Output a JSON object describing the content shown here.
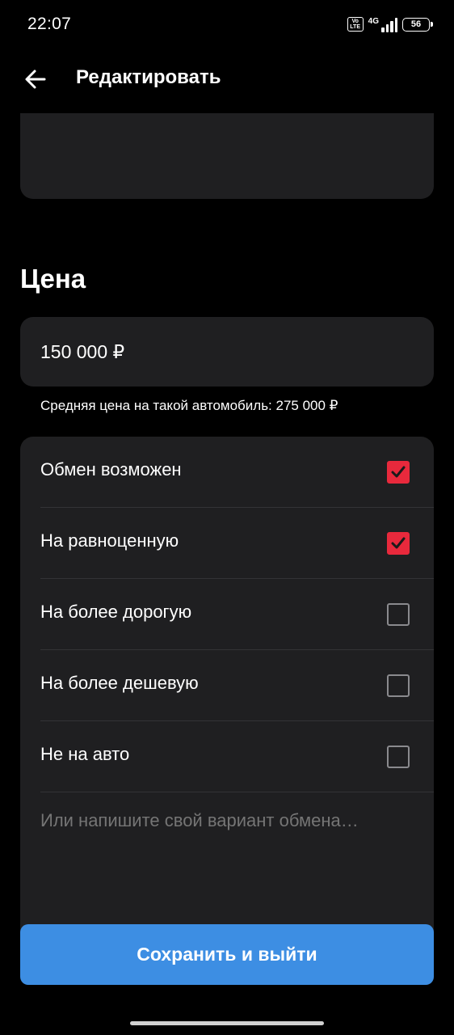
{
  "status_bar": {
    "time": "22:07",
    "volte_label": "Vo LTE",
    "network_label": "4G",
    "battery": "56"
  },
  "app_bar": {
    "title": "Редактировать",
    "back_icon": "arrow-left-icon"
  },
  "price_section": {
    "title": "Цена",
    "price_value": "150 000 ₽",
    "average_note": "Средняя цена на такой автомобиль: 275 000 ₽"
  },
  "exchange": {
    "options": [
      {
        "label": "Обмен возможен",
        "checked": true
      },
      {
        "label": "На равноценную",
        "checked": true
      },
      {
        "label": "На более дорогую",
        "checked": false
      },
      {
        "label": "На более дешевую",
        "checked": false
      },
      {
        "label": "Не на авто",
        "checked": false
      }
    ],
    "custom_placeholder": "Или напишите свой вариант обмена…"
  },
  "actions": {
    "save_label": "Сохранить и выйти"
  },
  "colors": {
    "background": "#000000",
    "card": "#1f1f21",
    "accent_red": "#e8293c",
    "primary_blue": "#3d8ee3",
    "muted_text": "#8a8a8e"
  }
}
